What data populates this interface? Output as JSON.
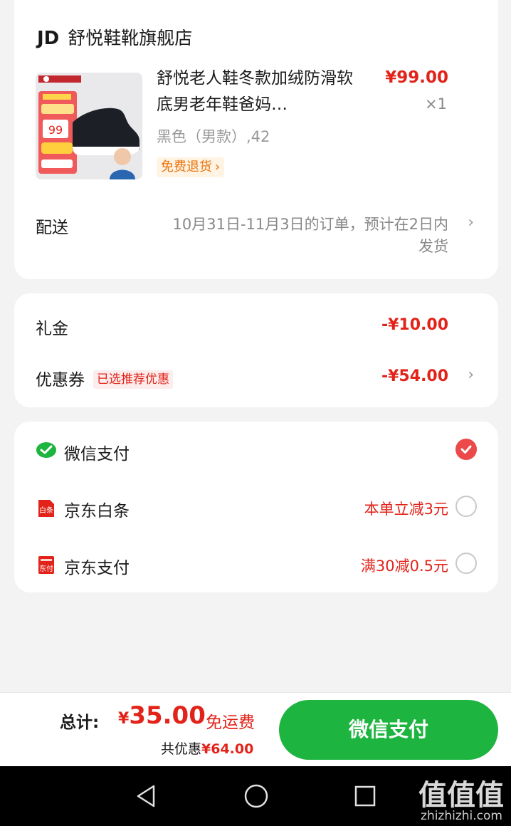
{
  "store": {
    "brand": "JD",
    "name": "舒悦鞋靴旗舰店"
  },
  "product": {
    "title": "舒悦老人鞋冬款加绒防滑软底男老年鞋爸妈…",
    "price": "¥99.00",
    "quantity": "×1",
    "variant": "黑色（男款）,42",
    "return_tag": "免费退货",
    "thumb_price": "99"
  },
  "delivery": {
    "label": "配送",
    "text": "10月31日-11月3日的订单，预计在2日内发货"
  },
  "discounts": {
    "gift": {
      "label": "礼金",
      "amount": "-¥10.00"
    },
    "coupon": {
      "label": "优惠券",
      "tag": "已选推荐优惠",
      "amount": "-¥54.00"
    }
  },
  "payment_methods": [
    {
      "label": "微信支付",
      "promo": "",
      "selected": true,
      "icon": "wechat-pay-icon"
    },
    {
      "label": "京东白条",
      "promo": "本单立减3元",
      "selected": false,
      "icon": "jd-baitiao-icon",
      "icon_text": "白条"
    },
    {
      "label": "京东支付",
      "promo": "满30减0.5元",
      "selected": false,
      "icon": "jd-pay-icon",
      "icon_text": "东付"
    }
  ],
  "bottom": {
    "total_label": "总计:",
    "total_yen": "¥",
    "total_value": "35.00",
    "shipping": "免运费",
    "saving_label": "共优惠",
    "saving_amount": "¥64.00",
    "pay_button": "微信支付"
  },
  "watermark": {
    "big": "值值值",
    "small": "zhizhizhi.com"
  },
  "colors": {
    "accent_red": "#e2231a",
    "wechat_green": "#1db43f"
  }
}
